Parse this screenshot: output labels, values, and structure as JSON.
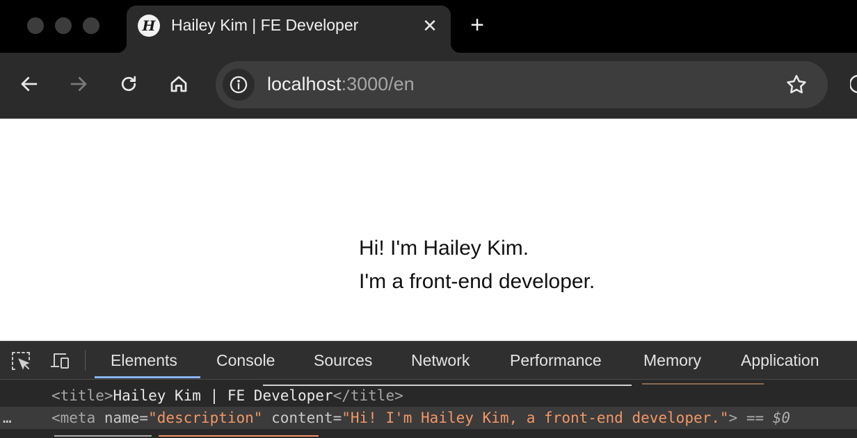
{
  "browser": {
    "tab": {
      "favicon_letter": "H",
      "title": "Hailey Kim | FE Developer",
      "close_glyph": "✕"
    },
    "new_tab_glyph": "+",
    "address": {
      "host": "localhost",
      "rest": ":3000/en"
    }
  },
  "page": {
    "line1": "Hi! I'm Hailey Kim.",
    "line2": "I'm a front-end developer."
  },
  "devtools": {
    "tabs": [
      "Elements",
      "Console",
      "Sources",
      "Network",
      "Performance",
      "Memory",
      "Application"
    ],
    "active_tab": "Elements",
    "code": {
      "title_open": "<title>",
      "title_text": "Hailey Kim | FE Developer",
      "title_close": "</title>",
      "meta_open": "<meta ",
      "meta_name_attr": "name=",
      "meta_name_val": "\"description\"",
      "meta_content_attr": " content=",
      "meta_content_val": "\"Hi! I'm Hailey Kim, a front-end developer.\"",
      "meta_close": ">",
      "selected_marker": "== $0",
      "row_dots": "…"
    }
  },
  "colors": {
    "accent": "#8ab4f8",
    "attr_value": "#f29766"
  }
}
